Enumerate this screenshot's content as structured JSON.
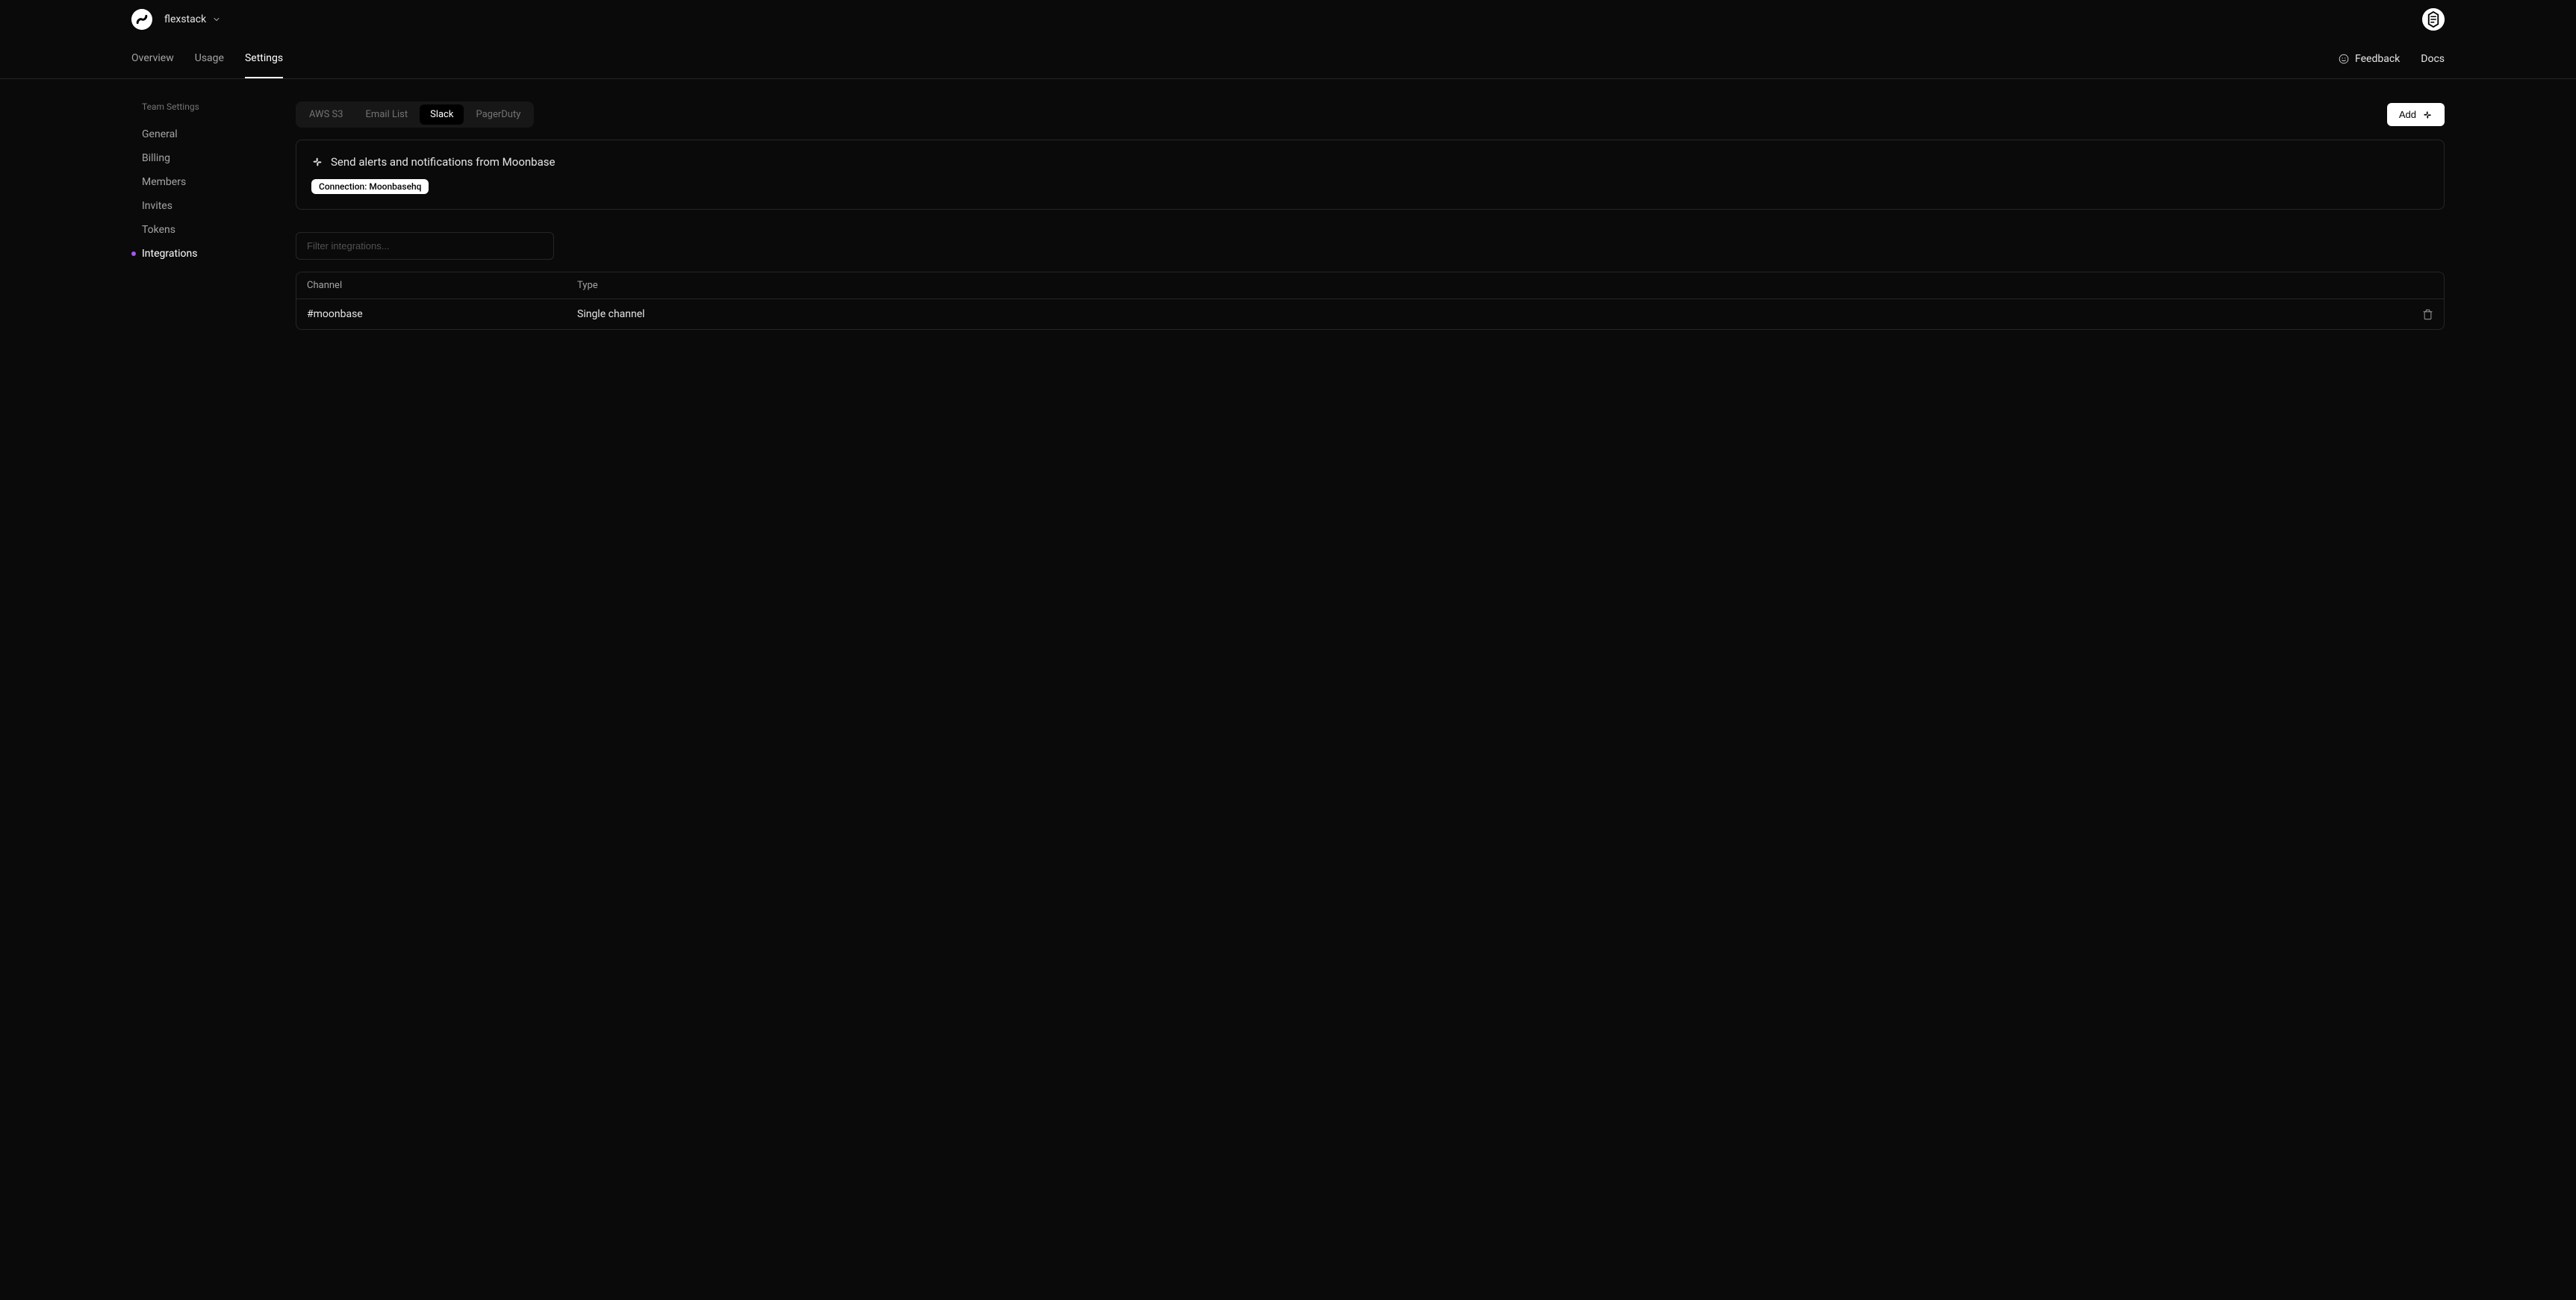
{
  "header": {
    "org_name": "flexstack"
  },
  "nav": {
    "tabs": [
      {
        "label": "Overview",
        "active": false
      },
      {
        "label": "Usage",
        "active": false
      },
      {
        "label": "Settings",
        "active": true
      }
    ],
    "feedback_label": "Feedback",
    "docs_label": "Docs"
  },
  "sidebar": {
    "heading": "Team Settings",
    "items": [
      {
        "label": "General",
        "active": false
      },
      {
        "label": "Billing",
        "active": false
      },
      {
        "label": "Members",
        "active": false
      },
      {
        "label": "Invites",
        "active": false
      },
      {
        "label": "Tokens",
        "active": false
      },
      {
        "label": "Integrations",
        "active": true
      }
    ]
  },
  "integrations": {
    "tabs": [
      {
        "label": "AWS S3",
        "active": false
      },
      {
        "label": "Email List",
        "active": false
      },
      {
        "label": "Slack",
        "active": true
      },
      {
        "label": "PagerDuty",
        "active": false
      }
    ],
    "add_button_label": "Add",
    "card": {
      "title": "Send alerts and notifications from Moonbase",
      "connection_badge": "Connection: Moonbasehq"
    },
    "filter_placeholder": "Filter integrations...",
    "table": {
      "columns": [
        {
          "label": "Channel"
        },
        {
          "label": "Type"
        }
      ],
      "rows": [
        {
          "channel": "#moonbase",
          "type": "Single channel"
        }
      ]
    }
  }
}
